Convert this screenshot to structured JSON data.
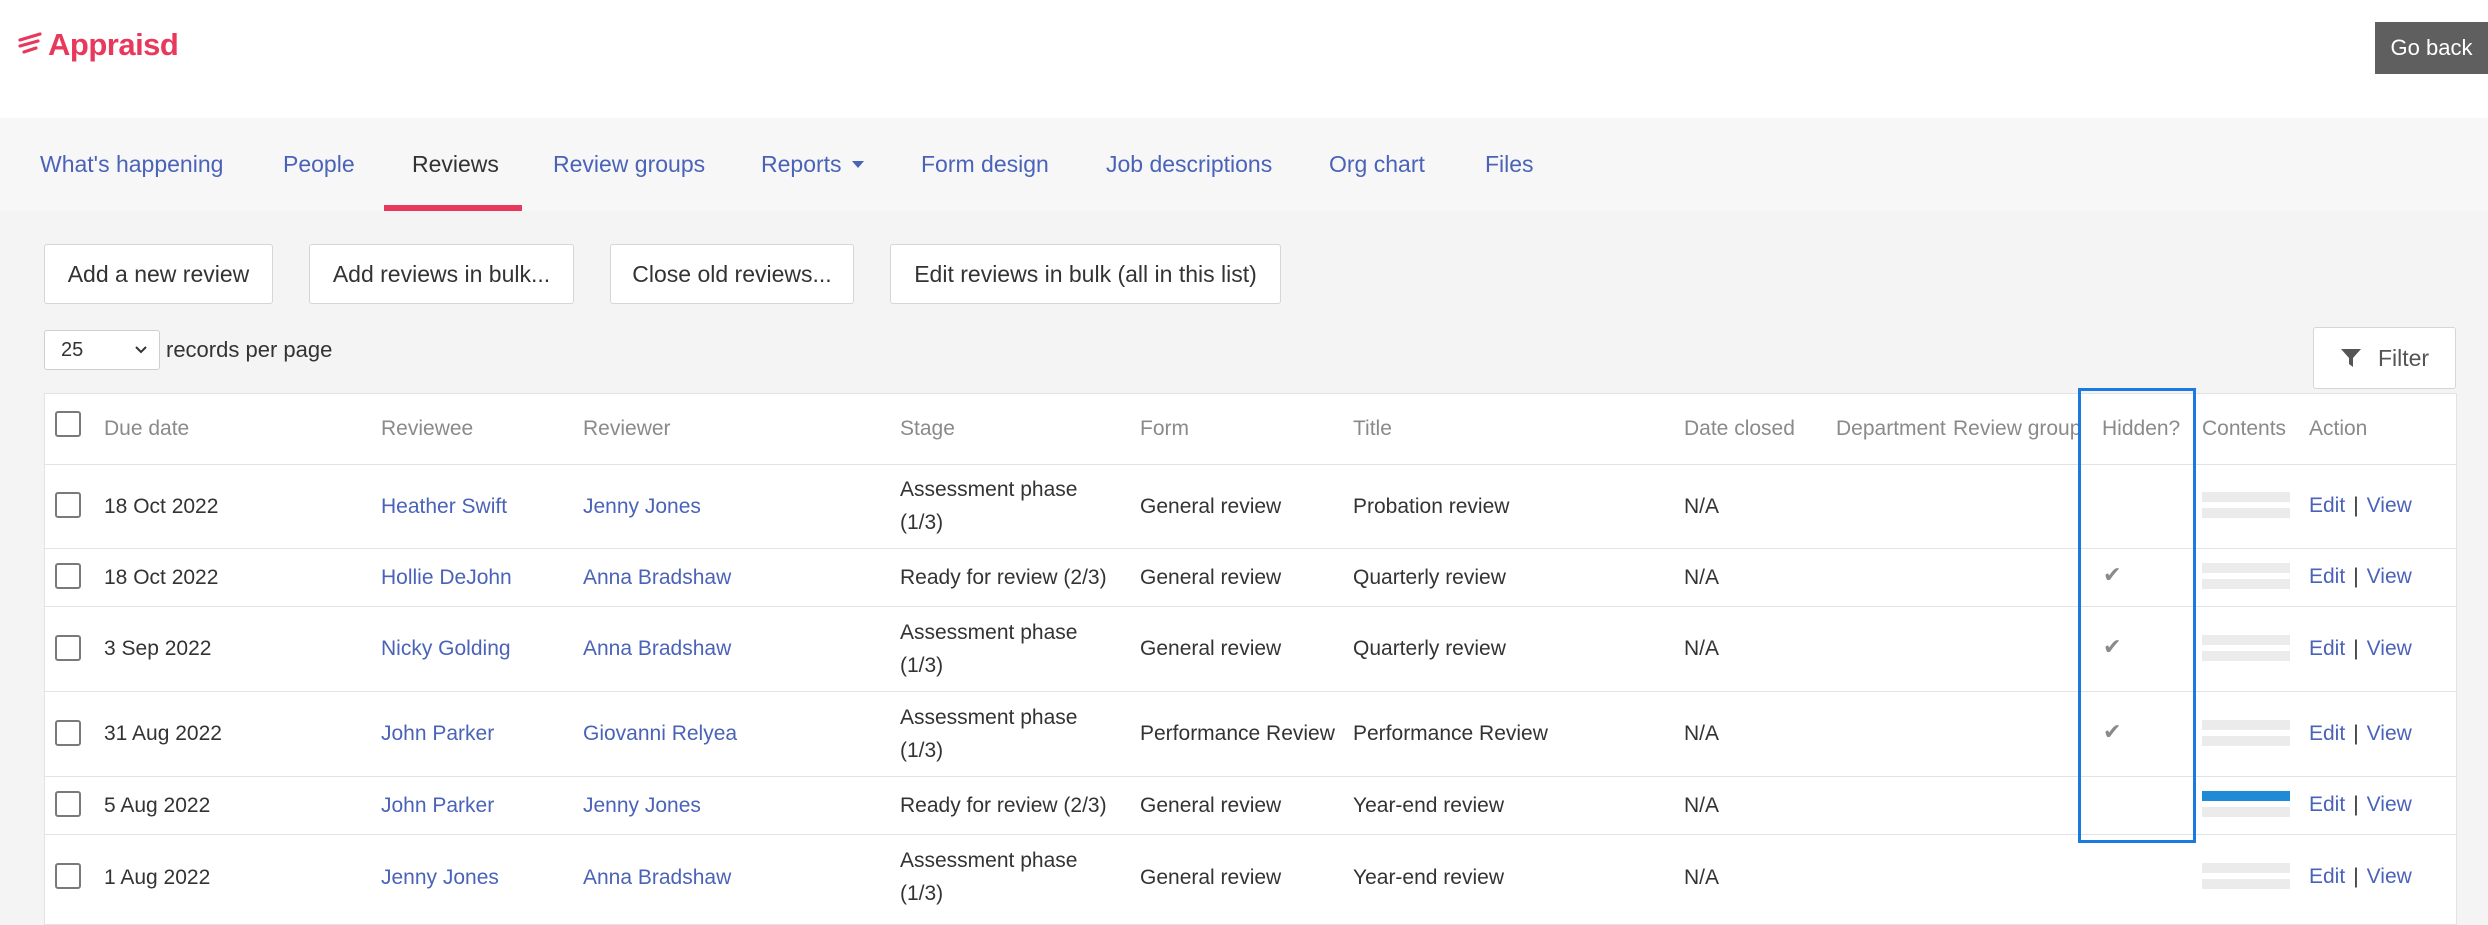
{
  "app": {
    "logo_text": "Appraisd",
    "go_back": "Go back"
  },
  "nav": {
    "items": [
      {
        "label": "What's happening"
      },
      {
        "label": "People"
      },
      {
        "label": "Reviews"
      },
      {
        "label": "Review groups"
      },
      {
        "label": "Reports"
      },
      {
        "label": "Form design"
      },
      {
        "label": "Job descriptions"
      },
      {
        "label": "Org chart"
      },
      {
        "label": "Files"
      }
    ],
    "active": "Reviews"
  },
  "toolbar": {
    "add_review": "Add a new review",
    "add_bulk": "Add reviews in bulk...",
    "close_old": "Close old reviews...",
    "edit_bulk": "Edit reviews in bulk (all in this list)"
  },
  "pagination": {
    "per_page": "25",
    "label": "records per page"
  },
  "filter": {
    "label": "Filter"
  },
  "table": {
    "headers": [
      "Due date",
      "Reviewee",
      "Reviewer",
      "Stage",
      "Form",
      "Title",
      "Date closed",
      "Department",
      "Review group",
      "Hidden?",
      "Contents",
      "Action"
    ],
    "action_edit": "Edit",
    "action_sep": "|",
    "action_view": "View",
    "rows": [
      {
        "due": "18 Oct 2022",
        "reviewee": "Heather Swift",
        "reviewer": "Jenny Jones",
        "stage": "Assessment phase (1/3)",
        "form": "General review",
        "title": "Probation review",
        "closed": "N/A",
        "hidden": false,
        "contents_progress": 0
      },
      {
        "due": "18 Oct 2022",
        "reviewee": "Hollie DeJohn",
        "reviewer": "Anna Bradshaw",
        "stage": "Ready for review (2/3)",
        "form": "General review",
        "title": "Quarterly review",
        "closed": "N/A",
        "hidden": true,
        "contents_progress": 0
      },
      {
        "due": "3 Sep 2022",
        "reviewee": "Nicky Golding",
        "reviewer": "Anna Bradshaw",
        "stage": "Assessment phase (1/3)",
        "form": "General review",
        "title": "Quarterly review",
        "closed": "N/A",
        "hidden": true,
        "contents_progress": 0
      },
      {
        "due": "31 Aug 2022",
        "reviewee": "John Parker",
        "reviewer": "Giovanni Relyea",
        "stage": "Assessment phase (1/3)",
        "form": "Performance Review",
        "title": "Performance Review",
        "closed": "N/A",
        "hidden": true,
        "contents_progress": 0
      },
      {
        "due": "5 Aug 2022",
        "reviewee": "John Parker",
        "reviewer": "Jenny Jones",
        "stage": "Ready for review (2/3)",
        "form": "General review",
        "title": "Year-end review",
        "closed": "N/A",
        "hidden": false,
        "contents_progress": 1
      },
      {
        "due": "1 Aug 2022",
        "reviewee": "Jenny Jones",
        "reviewer": "Anna Bradshaw",
        "stage": "Assessment phase (1/3)",
        "form": "General review",
        "title": "Year-end review",
        "closed": "N/A",
        "hidden": false,
        "contents_progress": 0
      }
    ]
  },
  "colors": {
    "brand": "#e8395c",
    "link": "#4a63b8",
    "highlight": "#1a7ae0",
    "progress": "#1f8ad6"
  }
}
